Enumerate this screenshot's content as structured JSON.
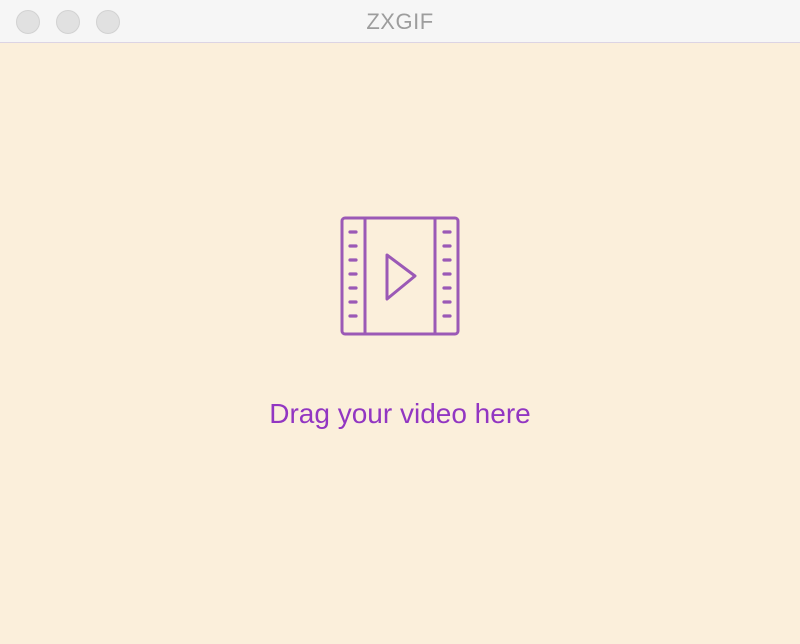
{
  "window": {
    "title": "ZXGIF",
    "background": "#fbefdb"
  },
  "titlebar": {
    "buttons": [
      {
        "name": "close-button"
      },
      {
        "name": "minimize-button"
      },
      {
        "name": "zoom-button"
      }
    ]
  },
  "dropzone": {
    "icon": "video-film-play-icon",
    "icon_color": "#9b59b6",
    "label": "Drag your video here",
    "label_color": "#9236c2"
  }
}
